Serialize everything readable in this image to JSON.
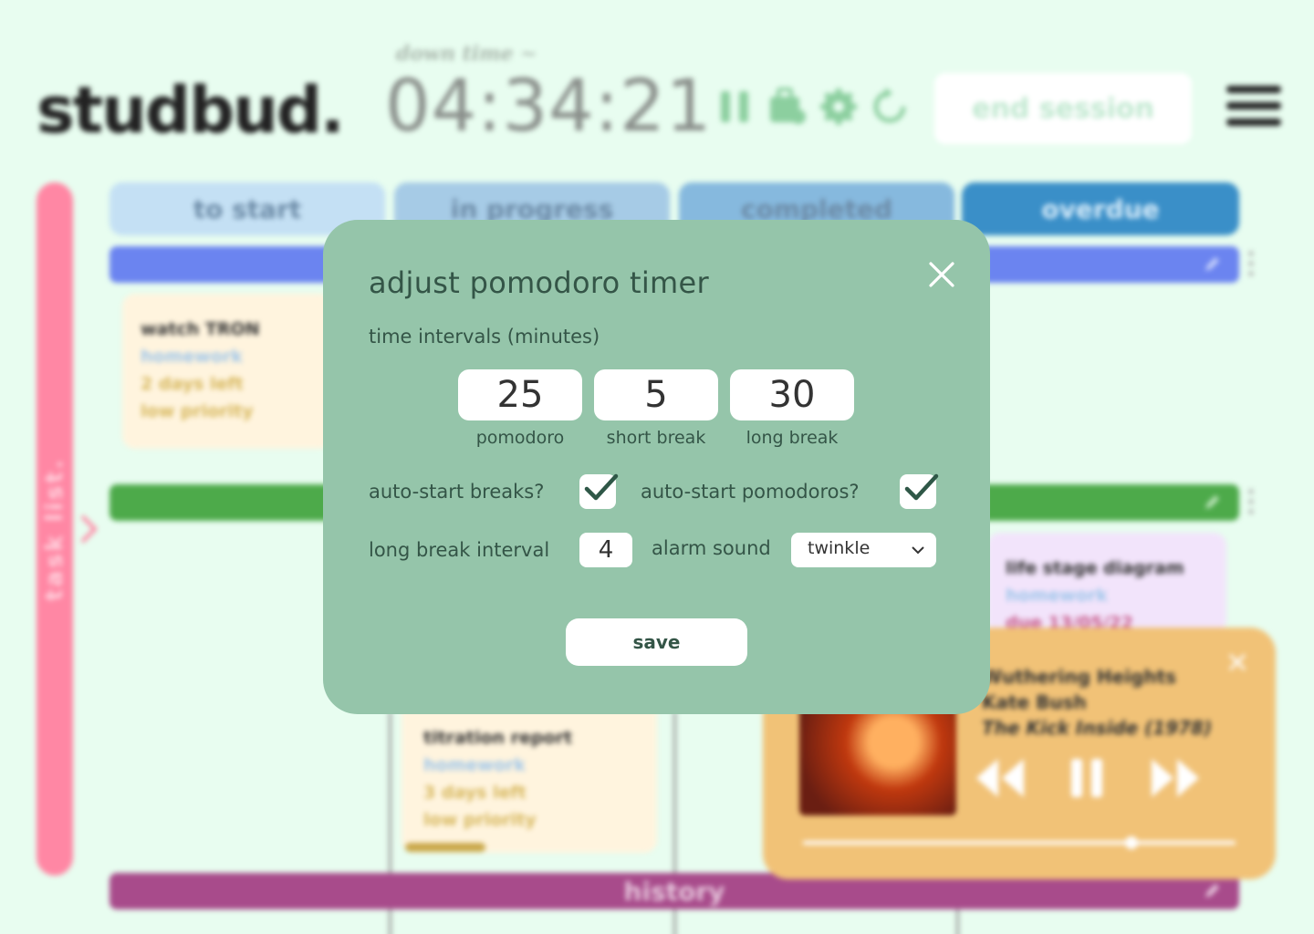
{
  "app": {
    "logo": "studbud.",
    "mode_label": "down time ~",
    "clock": "04:34:21",
    "end_session_label": "end session",
    "timer_control_icons": [
      "pause-icon",
      "briefcase-icon",
      "gear-icon",
      "restart-icon"
    ]
  },
  "task_list": {
    "label": "task list."
  },
  "columns": [
    {
      "label": "to start"
    },
    {
      "label": "in progress"
    },
    {
      "label": "completed"
    },
    {
      "label": "overdue"
    }
  ],
  "groups": {
    "history_label": "history"
  },
  "cards": [
    {
      "title": "watch TRON",
      "category": "homework",
      "due": "2 days left",
      "priority": "low priority"
    },
    {
      "title": "titration report",
      "category": "homework",
      "due": "3 days left",
      "priority": "low priority"
    },
    {
      "title": "life stage diagram",
      "category": "homework",
      "due": "due 13/05/22"
    }
  ],
  "player": {
    "song": "Wuthering Heights",
    "artist": "Kate Bush",
    "album": "The Kick Inside (1978)",
    "progress": 0.76
  },
  "modal": {
    "title": "adjust pomodoro timer",
    "section_label": "time intervals (minutes)",
    "pomodoro_value": "25",
    "pomodoro_label": "pomodoro",
    "short_break_value": "5",
    "short_break_label": "short break",
    "long_break_value": "30",
    "long_break_label": "long break",
    "auto_start_breaks_label": "auto-start breaks?",
    "auto_start_breaks_checked": true,
    "auto_start_pomodoros_label": "auto-start pomodoros?",
    "auto_start_pomodoros_checked": true,
    "long_break_interval_label": "long break interval",
    "long_break_interval_value": "4",
    "alarm_sound_label": "alarm sound",
    "alarm_sound_value": "twinkle",
    "save_label": "save"
  },
  "colors": {
    "background": "#e8fdf0",
    "modal": "#95c5aa",
    "modal_text": "#345547",
    "tasklist": "#ff87a4",
    "overdue": "#3a8fc8",
    "player": "#f1c277",
    "history": "#a84b8b"
  }
}
